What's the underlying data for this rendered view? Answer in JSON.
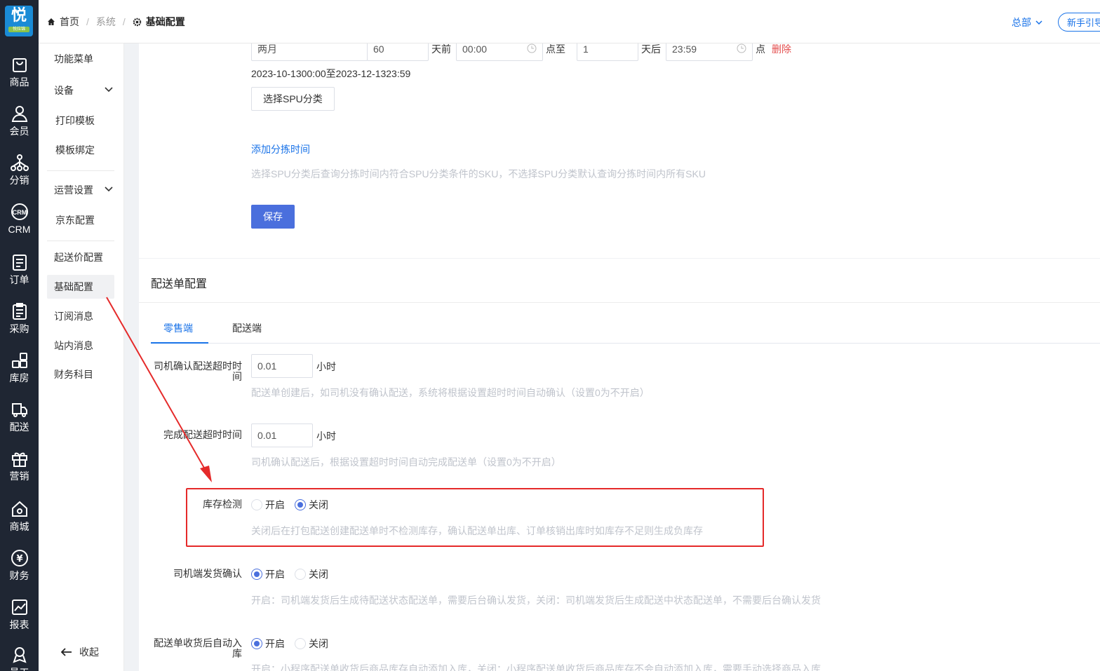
{
  "logo": {
    "glyph": "悦",
    "tagline": "悦拉锦"
  },
  "rail": [
    {
      "name": "goods",
      "label": "商品"
    },
    {
      "name": "member",
      "label": "会员"
    },
    {
      "name": "distribution",
      "label": "分销"
    },
    {
      "name": "crm",
      "label": "CRM",
      "icon_text": "CRM"
    },
    {
      "name": "order",
      "label": "订单"
    },
    {
      "name": "purchase",
      "label": "采购"
    },
    {
      "name": "warehouse",
      "label": "库房"
    },
    {
      "name": "delivery",
      "label": "配送"
    },
    {
      "name": "marketing",
      "label": "营销"
    },
    {
      "name": "mall",
      "label": "商城"
    },
    {
      "name": "finance",
      "label": "财务",
      "icon_text": "¥"
    },
    {
      "name": "report",
      "label": "报表"
    },
    {
      "name": "staff",
      "label": "员工"
    }
  ],
  "breadcrumb": {
    "home": "首页",
    "system": "系统",
    "current": "基础配置"
  },
  "top_right": {
    "org": "总部",
    "guide": "新手引导"
  },
  "subnav": {
    "items": [
      {
        "label": "功能菜单"
      },
      {
        "label": "设备"
      },
      {
        "label": "打印模板"
      },
      {
        "label": "模板绑定"
      },
      {
        "label": "运营设置"
      },
      {
        "label": "京东配置"
      },
      {
        "label": "起送价配置"
      },
      {
        "label": "基础配置"
      },
      {
        "label": "订阅消息"
      },
      {
        "label": "站内消息"
      },
      {
        "label": "财务科目"
      }
    ],
    "collapse": "收起"
  },
  "sort_time": {
    "row": {
      "period": "两月",
      "days_before": "60",
      "days_before_suffix": "天前",
      "start_time": "00:00",
      "to_label": "点至",
      "days_after": "1",
      "days_after_suffix": "天后",
      "end_time": "23:59",
      "point_suffix": "点",
      "delete": "删除"
    },
    "range_text": "2023-10-1300:00至2023-12-1323:59",
    "select_spu": "选择SPU分类",
    "add_sort_time": "添加分拣时间",
    "hint": "选择SPU分类后查询分拣时间内符合SPU分类条件的SKU，不选择SPU分类默认查询分拣时间内所有SKU",
    "save": "保存"
  },
  "delivery": {
    "title": "配送单配置",
    "tabs": [
      "零售端",
      "配送端"
    ],
    "driver_confirm": {
      "label": "司机确认配送超时时间",
      "value": "0.01",
      "unit": "小时",
      "hint": "配送单创建后，如司机没有确认配送，系统将根据设置超时时间自动确认（设置0为不开启）"
    },
    "complete_timeout": {
      "label": "完成配送超时时间",
      "value": "0.01",
      "unit": "小时",
      "hint": "司机确认配送后，根据设置超时时间自动完成配送单（设置0为不开启）"
    },
    "stock_check": {
      "label": "库存检测",
      "on": "开启",
      "off": "关闭",
      "selected": "off",
      "hint": "关闭后在打包配送创建配送单时不检测库存，确认配送单出库、订单核销出库时如库存不足则生成负库存"
    },
    "driver_ship_confirm": {
      "label": "司机端发货确认",
      "on": "开启",
      "off": "关闭",
      "selected": "on",
      "hint": "开启：司机端发货后生成待配送状态配送单，需要后台确认发货，关闭：司机端发货后生成配送中状态配送单，不需要后台确认发货"
    },
    "auto_stock_in": {
      "label": "配送单收货后自动入库",
      "on": "开启",
      "off": "关闭",
      "selected": "on",
      "hint": "开启：小程序配送单收货后商品库存自动添加入库，关闭：小程序配送单收货后商品库存不会自动添加入库，需要手动选择商品入库"
    }
  },
  "colors": {
    "primary": "#4a6fdd",
    "link": "#1a73e8",
    "annotation": "#e52a2a",
    "rail_bg": "#1f2633"
  }
}
